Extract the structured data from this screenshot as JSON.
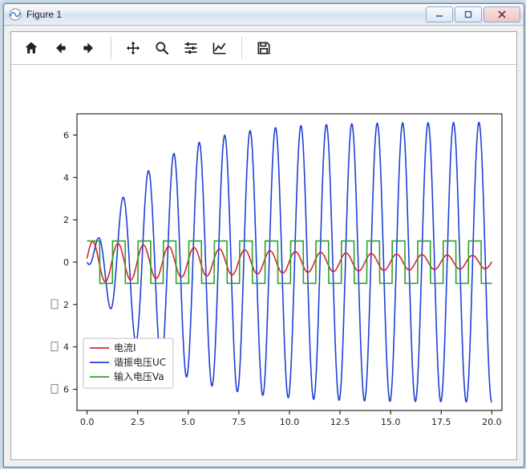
{
  "window": {
    "title": "Figure 1"
  },
  "toolbar": {
    "home": "Home",
    "back": "Back",
    "fwd": "Forward",
    "pan": "Pan",
    "zoom": "Zoom",
    "subplots": "Configure subplots",
    "edit": "Edit axis",
    "save": "Save"
  },
  "legend": {
    "items": [
      "电流I",
      "谐振电压UC",
      "输入电压Va"
    ]
  },
  "axes": {
    "xticks": [
      "0.0",
      "2.5",
      "5.0",
      "7.5",
      "10.0",
      "12.5",
      "15.0",
      "17.5",
      "20.0"
    ],
    "yticks": [
      "6",
      "4",
      "2",
      "0",
      "2",
      "4",
      "6"
    ]
  },
  "chart_data": {
    "type": "line",
    "xlabel": "",
    "ylabel": "",
    "xlim": [
      -0.5,
      20.5
    ],
    "ylim": [
      -7,
      7
    ],
    "grid": false,
    "legend_pos": "lower left",
    "x_step": 0.01,
    "series": [
      {
        "name": "电流I",
        "color": "#d62728",
        "formula": "exp(-0.08*t)*sin(5*t) + 0.19*sin(5*t+1.2)",
        "approx_amplitude": 1.0,
        "freq_rad_per_s": 5.0
      },
      {
        "name": "谐振电压UC",
        "color": "#1f3fd8",
        "formula": "6.6*(1-exp(-0.35*t))*sin(5*t - 1.0)",
        "steady_amplitude": 6.6,
        "freq_rad_per_s": 5.0
      },
      {
        "name": "输入电压Va",
        "color": "#2ca02c",
        "formula": "square(5*t), amplitude 1",
        "amplitude": 1.0,
        "freq_rad_per_s": 5.0
      }
    ],
    "xticks": [
      0.0,
      2.5,
      5.0,
      7.5,
      10.0,
      12.5,
      15.0,
      17.5,
      20.0
    ],
    "yticks": [
      -6,
      -4,
      -2,
      0,
      2,
      4,
      6
    ]
  }
}
